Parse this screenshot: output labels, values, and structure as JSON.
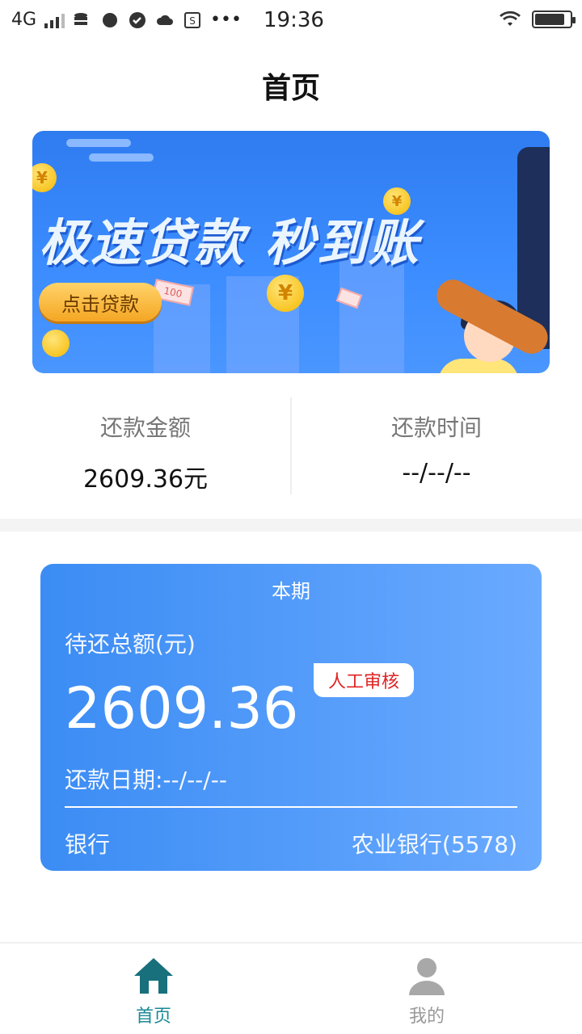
{
  "status_bar": {
    "network": "4G",
    "time": "19:36",
    "more": "•••"
  },
  "header": {
    "title": "首页"
  },
  "banner": {
    "headline": "极速贷款 秒到账",
    "button": "点击贷款",
    "coin_symbol": "¥",
    "note_text": "100"
  },
  "summary": {
    "amount_label": "还款金额",
    "amount_value": "2609.36元",
    "time_label": "还款时间",
    "time_value": "--/--/--"
  },
  "period_card": {
    "title": "本期",
    "total_label": "待还总额(元)",
    "total_amount": "2609.36",
    "badge": "人工审核",
    "date_label": "还款日期:--/--/--",
    "bank_label": "银行",
    "bank_value": "农业银行(5578)"
  },
  "tabs": [
    {
      "label": "首页",
      "icon": "home-icon",
      "active": true,
      "color": "#1a8a96"
    },
    {
      "label": "我的",
      "icon": "user-icon",
      "active": false,
      "color": "#999999"
    }
  ],
  "colors": {
    "accent": "#3b8cf4",
    "badge_text": "#e02424",
    "tab_active": "#1a8a96"
  }
}
